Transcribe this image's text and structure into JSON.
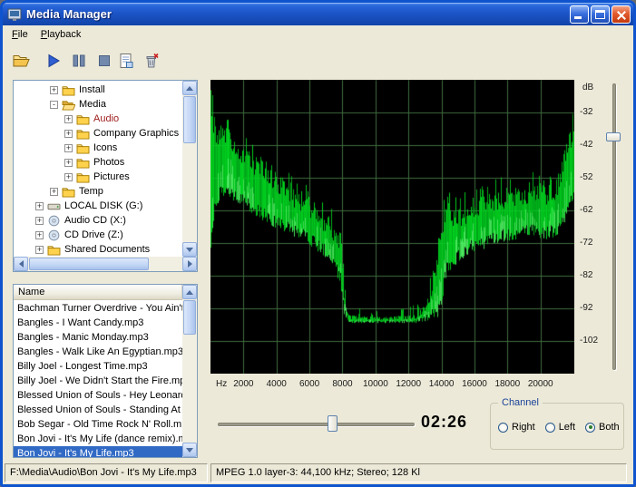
{
  "window": {
    "title": "Media Manager",
    "controls": [
      "minimize",
      "maximize",
      "close"
    ]
  },
  "menu": {
    "items": [
      {
        "label": "File"
      },
      {
        "label": "Playback"
      }
    ]
  },
  "toolbar": {
    "buttons": [
      {
        "name": "open",
        "icon": "open-folder-icon"
      },
      {
        "name": "play",
        "icon": "play-icon"
      },
      {
        "name": "pause",
        "icon": "pause-icon"
      },
      {
        "name": "stop",
        "icon": "stop-icon"
      },
      {
        "name": "playlist",
        "icon": "document-icon"
      },
      {
        "name": "delete",
        "icon": "trash-icon"
      }
    ]
  },
  "tree": {
    "items": [
      {
        "label": "Install",
        "level": 1,
        "expander": "+",
        "icon": "folder"
      },
      {
        "label": "Media",
        "level": 1,
        "expander": "-",
        "icon": "folder-open"
      },
      {
        "label": "Audio",
        "level": 2,
        "expander": "+",
        "icon": "folder",
        "highlight": true
      },
      {
        "label": "Company Graphics",
        "level": 2,
        "expander": "+",
        "icon": "folder"
      },
      {
        "label": "Icons",
        "level": 2,
        "expander": "+",
        "icon": "folder"
      },
      {
        "label": "Photos",
        "level": 2,
        "expander": "+",
        "icon": "folder"
      },
      {
        "label": "Pictures",
        "level": 2,
        "expander": "+",
        "icon": "folder"
      },
      {
        "label": "Temp",
        "level": 1,
        "expander": "+",
        "icon": "folder"
      },
      {
        "label": "LOCAL DISK (G:)",
        "level": 0,
        "expander": "+",
        "icon": "drive"
      },
      {
        "label": "Audio CD (X:)",
        "level": 0,
        "expander": "+",
        "icon": "cd"
      },
      {
        "label": "CD Drive (Z:)",
        "level": 0,
        "expander": "+",
        "icon": "cd"
      },
      {
        "label": "Shared Documents",
        "level": 0,
        "expander": "+",
        "icon": "folder"
      }
    ]
  },
  "filelist": {
    "header": "Name",
    "selected_index": 10,
    "items": [
      "Bachman Turner Overdrive - You Ain't",
      "Bangles - I Want Candy.mp3",
      "Bangles - Manic Monday.mp3",
      "Bangles - Walk Like An Egyptian.mp3",
      "Billy Joel - Longest Time.mp3",
      "Billy Joel - We Didn't Start the Fire.mp3",
      "Blessed Union of Souls - Hey Leonardo",
      "Blessed Union of Souls - Standing At T",
      "Bob Segar - Old Time Rock N' Roll.mp",
      "Bon Jovi - It's My Life (dance remix).mp",
      "Bon Jovi - It's My Life.mp3"
    ]
  },
  "chart_data": {
    "type": "area",
    "title": "Audio frequency spectrum analyzer",
    "xlabel": "Hz",
    "ylabel": "dB",
    "x_ticks": [
      2000,
      4000,
      6000,
      8000,
      10000,
      12000,
      14000,
      16000,
      18000,
      20000
    ],
    "y_ticks": [
      -32,
      -42,
      -52,
      -62,
      -72,
      -82,
      -92,
      -102
    ],
    "xlim": [
      0,
      22050
    ],
    "ylim": [
      -112,
      -22
    ],
    "grid": true,
    "grid_color": "#3E6B3E",
    "series_color": "#00D21E",
    "envelope_hz_topdb_botdb": [
      [
        0,
        -26,
        -75
      ],
      [
        250,
        -34,
        -62
      ],
      [
        600,
        -36,
        -58
      ],
      [
        1000,
        -35,
        -58
      ],
      [
        1600,
        -39,
        -60
      ],
      [
        2200,
        -42,
        -62
      ],
      [
        2800,
        -45,
        -64
      ],
      [
        3400,
        -48,
        -66
      ],
      [
        4200,
        -51,
        -68
      ],
      [
        5000,
        -54,
        -70
      ],
      [
        5800,
        -57,
        -72
      ],
      [
        6600,
        -60,
        -75
      ],
      [
        7300,
        -64,
        -78
      ],
      [
        7900,
        -68,
        -85
      ],
      [
        8100,
        -85,
        -95
      ],
      [
        8400,
        -94,
        -96.5
      ],
      [
        9500,
        -94.5,
        -96.5
      ],
      [
        11000,
        -94.5,
        -96.5
      ],
      [
        12500,
        -94,
        -96.5
      ],
      [
        13200,
        -87,
        -96
      ],
      [
        13700,
        -76,
        -96
      ],
      [
        14000,
        -66,
        -92
      ],
      [
        14300,
        -58,
        -82
      ],
      [
        15000,
        -61,
        -78
      ],
      [
        15800,
        -58,
        -75
      ],
      [
        16600,
        -57,
        -74
      ],
      [
        17500,
        -55,
        -72
      ],
      [
        18500,
        -54,
        -71
      ],
      [
        19500,
        -53,
        -70
      ],
      [
        20300,
        -54,
        -71
      ],
      [
        21000,
        -52,
        -70
      ],
      [
        21600,
        -40,
        -66
      ],
      [
        22050,
        -34,
        -58
      ]
    ]
  },
  "transport": {
    "time": "02:26"
  },
  "channel": {
    "label": "Channel",
    "options": [
      {
        "label": "Right",
        "selected": false
      },
      {
        "label": "Left",
        "selected": false
      },
      {
        "label": "Both",
        "selected": true
      }
    ]
  },
  "statusbar": {
    "file_path": "F:\\Media\\Audio\\Bon Jovi - It's My Life.mp3",
    "format_info": "MPEG 1.0 layer-3: 44,100 kHz; Stereo; 128 Kl"
  }
}
